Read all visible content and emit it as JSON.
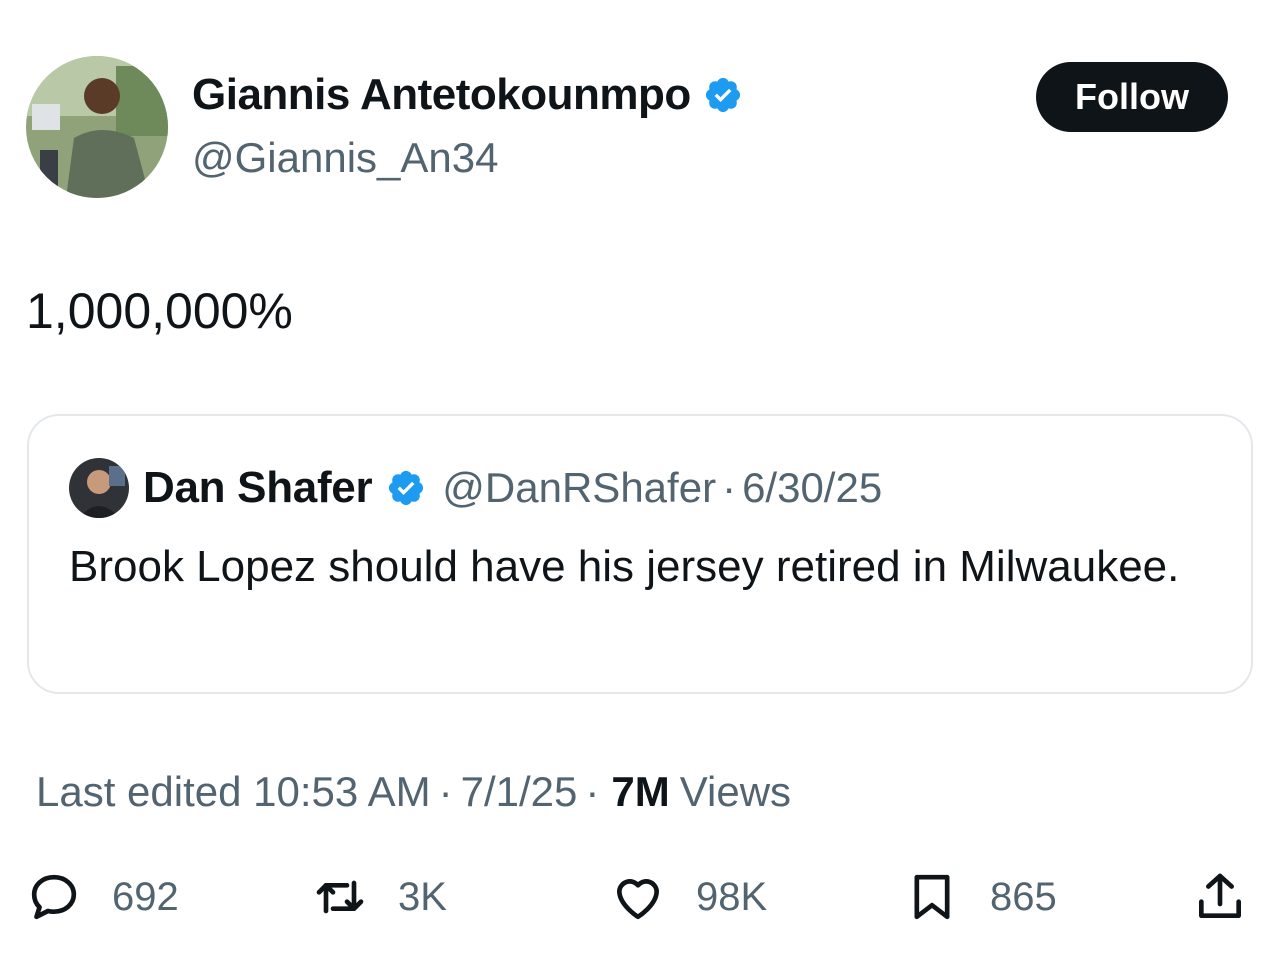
{
  "author": {
    "name": "Giannis Antetokounmpo",
    "handle": "@Giannis_An34",
    "avatar_icon": "profile-photo",
    "verified_icon": "verified-badge-icon"
  },
  "follow_label": "Follow",
  "tweet_text": "1,000,000%",
  "quote": {
    "name": "Dan Shafer",
    "handle": "@DanRShafer",
    "separator": "·",
    "date": "6/30/25",
    "text": "Brook Lopez should have his jersey retired in Milwaukee."
  },
  "meta": {
    "edited": "Last edited 10:53 AM",
    "sep1": "·",
    "date": "7/1/25",
    "sep2": "·",
    "views_count": "7M",
    "views_label": "Views"
  },
  "actions": {
    "replies": "692",
    "reposts": "3K",
    "likes": "98K",
    "bookmarks": "865"
  },
  "colors": {
    "text": "#0f1419",
    "secondary": "#536471",
    "verified": "#1d9bf0",
    "border": "#e4e8eb",
    "button_bg": "#0f1419"
  }
}
